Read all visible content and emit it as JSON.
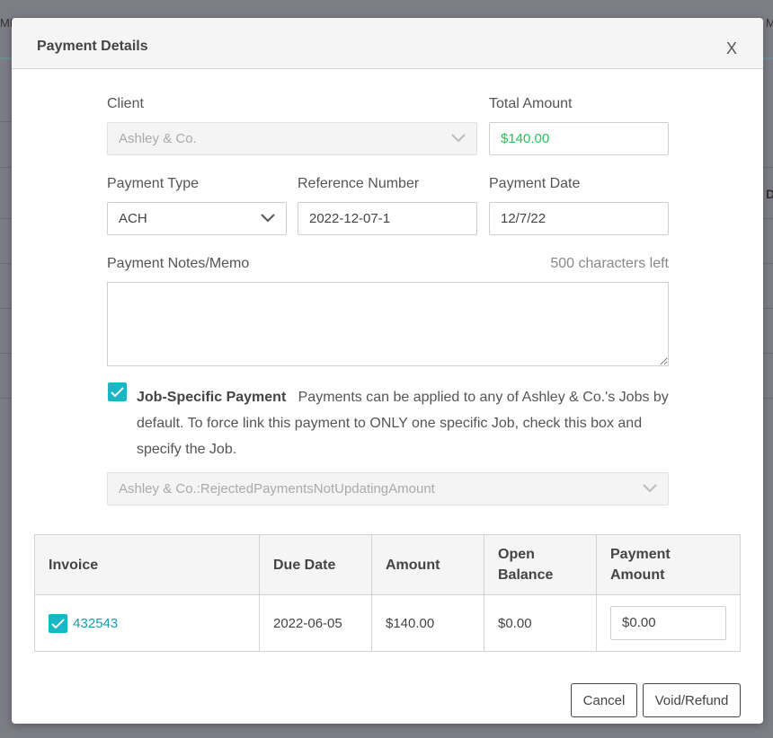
{
  "background": {
    "left_fragment": "ME",
    "right_fragment": "M",
    "right_d": "D"
  },
  "modal": {
    "title": "Payment Details",
    "close_label": "X"
  },
  "form": {
    "client_label": "Client",
    "client_value": "Ashley & Co.",
    "total_amount_label": "Total Amount",
    "total_amount_value": "$140.00",
    "total_amount_color": "#1fc65a",
    "payment_type_label": "Payment Type",
    "payment_type_value": "ACH",
    "reference_number_label": "Reference Number",
    "reference_number_value": "2022-12-07-1",
    "payment_date_label": "Payment Date",
    "payment_date_value": "12/7/22",
    "memo_label": "Payment Notes/Memo",
    "memo_chars_left": "500 characters left",
    "memo_value": ""
  },
  "job_specific": {
    "checked": true,
    "label": "Job-Specific Payment",
    "description": "Payments can be applied to any of Ashley & Co.'s Jobs by default. To force link this payment to ONLY one specific Job, check this box and specify the Job.",
    "job_value": "Ashley & Co.:RejectedPaymentsNotUpdatingAmount"
  },
  "invoice_table": {
    "headers": {
      "invoice": "Invoice",
      "due_date": "Due Date",
      "amount": "Amount",
      "open_balance_1": "Open",
      "open_balance_2": "Balance",
      "payment_amount_1": "Payment",
      "payment_amount_2": "Amount"
    },
    "rows": [
      {
        "checked": true,
        "invoice": "432543",
        "due_date": "2022-06-05",
        "amount": "$140.00",
        "open_balance": "$0.00",
        "payment_amount": "$0.00"
      }
    ]
  },
  "footer": {
    "cancel_label": "Cancel",
    "void_refund_label": "Void/Refund"
  },
  "colors": {
    "accent": "#19b6c5",
    "link": "#1a9bb0"
  }
}
